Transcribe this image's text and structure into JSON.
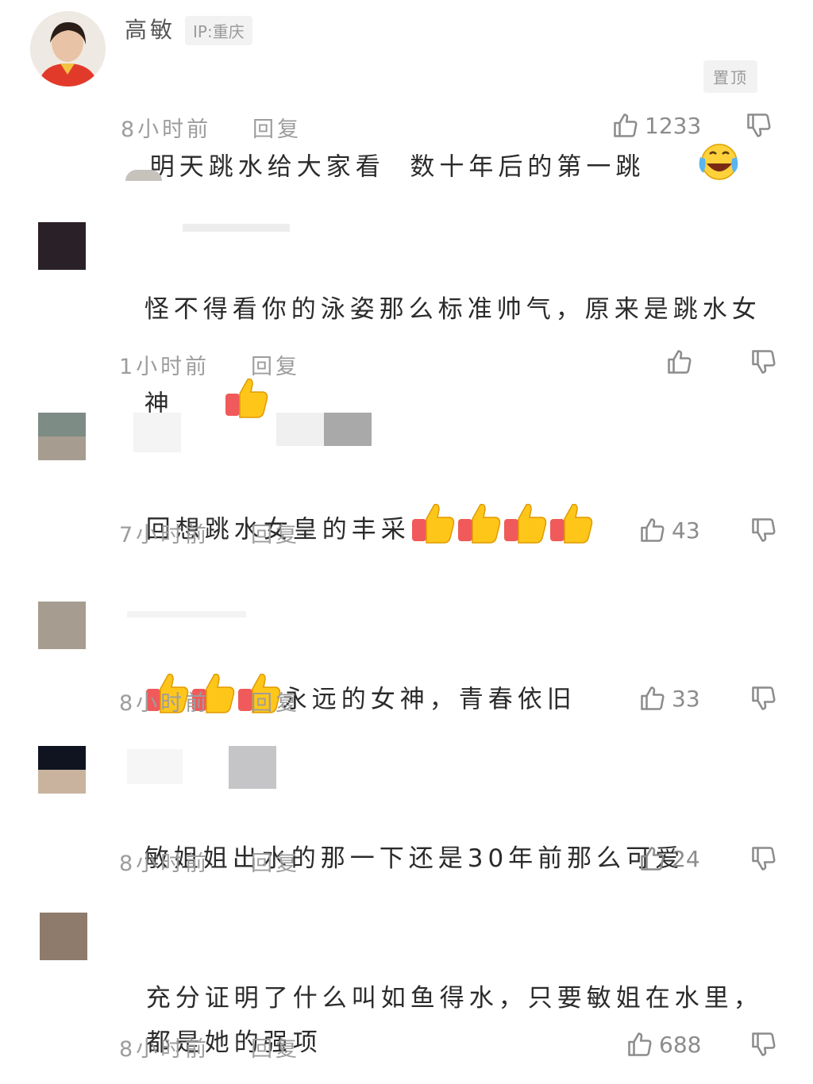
{
  "top_comment": {
    "author": "高敏",
    "ip_label": "IP:重庆",
    "text": "明天跳水给大家看  数十年后的第一跳",
    "pin_label": "置顶",
    "time": "8小时前",
    "reply": "回复",
    "likes": "1233"
  },
  "comments": [
    {
      "text_line1": "怪不得看你的泳姿那么标准帅气，原来是跳水女",
      "text_line2": "神",
      "time": "1小时前",
      "reply": "回复",
      "likes": ""
    },
    {
      "text_line1": "回想跳水女皇的丰采",
      "time": "7小时前",
      "reply": "回复",
      "likes": "43"
    },
    {
      "text_line1": "永远的女神，青春依旧",
      "time": "8小时前",
      "reply": "回复",
      "likes": "33"
    },
    {
      "text_line1": "敏姐姐出水的那一下还是30年前那么可爱",
      "time": "8小时前",
      "reply": "回复",
      "likes": "24"
    },
    {
      "text_line1": "充分证明了什么叫如鱼得水，只要敏姐在水里，",
      "text_line2": "都是她的强项",
      "time": "8小时前",
      "reply": "回复",
      "likes": "688"
    }
  ],
  "colors": {
    "text": "#2b2b2b",
    "meta": "#9d9d9d",
    "avatar_dark": "#2a2027",
    "avatar_green": "#7d8c85",
    "avatar_beige": "#a69d90",
    "avatar_navy": "#0f1420",
    "avatar_tan": "#c9b39f",
    "avatar_brown": "#8e7b6b"
  },
  "icons": [
    "thumbs-up-icon",
    "thumbs-down-icon",
    "laughing-emoji-icon",
    "thumbs-up-emoji-icon"
  ]
}
